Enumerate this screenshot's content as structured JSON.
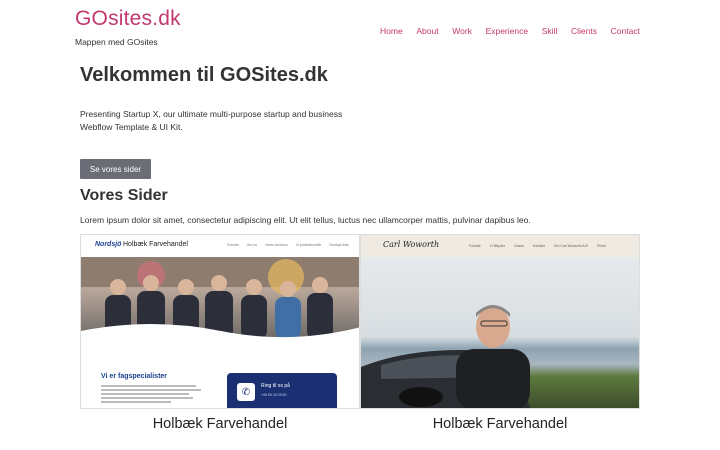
{
  "site": {
    "logo": "GOsites.dk",
    "tagline": "Mappen med GOsites"
  },
  "nav": [
    {
      "label": "Home"
    },
    {
      "label": "About"
    },
    {
      "label": "Work"
    },
    {
      "label": "Experience"
    },
    {
      "label": "Skill"
    },
    {
      "label": "Clients"
    },
    {
      "label": "Contact"
    }
  ],
  "hero": {
    "title": "Velkommen til GOSites.dk",
    "text": "Presenting Startup X, our ultimate multi-purpose startup and business Webflow Template & UI Kit.",
    "cta": "Se vores sider"
  },
  "section": {
    "title": "Vores Sider",
    "text": "Lorem ipsum dolor sit amet, consectetur adipiscing elit. Ut elit tellus, luctus nec ullamcorper mattis, pulvinar dapibus leo."
  },
  "cards": [
    {
      "title": "Holbæk Farvehandel",
      "shot": {
        "logo": "Nordsjö",
        "brand": "Holbæk Farvehandel",
        "nav": [
          "Forside",
          "Om os",
          "Vores services",
          "Vi professionelle",
          "Nordsjö-liste"
        ],
        "heading": "Vi er fagspecialister",
        "call": "Ring til os på",
        "phone": "+45 59 43 09 60",
        "phone_glyph": "✆"
      }
    },
    {
      "title": "Holbæk Farvehandel",
      "shot": {
        "logo": "Carl Woworth",
        "nav": [
          "Forside",
          "Vi tilbyder",
          "Cases",
          "Kontakt",
          "Om Carl Woworth A/S",
          "Priser"
        ]
      }
    }
  ],
  "colors": {
    "brand": "#c2386f",
    "button": "#6b6d76",
    "nordsjo_blue": "#1b2f73"
  }
}
